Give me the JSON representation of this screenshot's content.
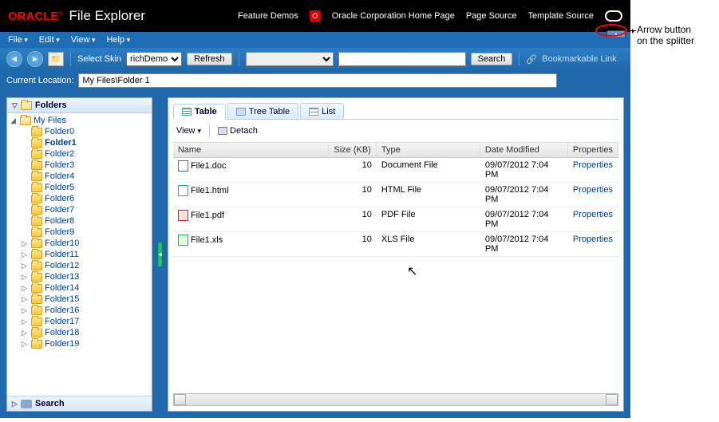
{
  "header": {
    "logo_brand": "ORACLE",
    "app_title": "File Explorer",
    "links": {
      "feature_demos": "Feature Demos",
      "home": "Oracle Corporation Home Page",
      "page_source": "Page Source",
      "template_source": "Template Source"
    }
  },
  "menubar": {
    "file": "File",
    "edit": "Edit",
    "view": "View",
    "help": "Help"
  },
  "toolbar": {
    "select_skin_label": "Select Skin",
    "skin_value": "richDemo",
    "refresh": "Refresh",
    "search": "Search",
    "bookmarkable": "Bookmarkable Link"
  },
  "location": {
    "label": "Current Location:",
    "value": "My Files\\Folder 1"
  },
  "sidebar": {
    "folders_title": "Folders",
    "search_title": "Search",
    "root": "My Files",
    "items": [
      {
        "label": "Folder0",
        "exp": false
      },
      {
        "label": "Folder1",
        "exp": false,
        "selected": true
      },
      {
        "label": "Folder2",
        "exp": false
      },
      {
        "label": "Folder3",
        "exp": false
      },
      {
        "label": "Folder4",
        "exp": false
      },
      {
        "label": "Folder5",
        "exp": false
      },
      {
        "label": "Folder6",
        "exp": false
      },
      {
        "label": "Folder7",
        "exp": false
      },
      {
        "label": "Folder8",
        "exp": false
      },
      {
        "label": "Folder9",
        "exp": false
      },
      {
        "label": "Folder10",
        "exp": true
      },
      {
        "label": "Folder11",
        "exp": true
      },
      {
        "label": "Folder12",
        "exp": true
      },
      {
        "label": "Folder13",
        "exp": true
      },
      {
        "label": "Folder14",
        "exp": true
      },
      {
        "label": "Folder15",
        "exp": true
      },
      {
        "label": "Folder16",
        "exp": true
      },
      {
        "label": "Folder17",
        "exp": true
      },
      {
        "label": "Folder18",
        "exp": true
      },
      {
        "label": "Folder19",
        "exp": true
      }
    ]
  },
  "tabs": {
    "table": "Table",
    "tree_table": "Tree Table",
    "list": "List"
  },
  "subtoolbar": {
    "view": "View",
    "detach": "Detach"
  },
  "grid": {
    "columns": {
      "name": "Name",
      "size": "Size (KB)",
      "type": "Type",
      "date": "Date Modified",
      "props": "Properties"
    },
    "rows": [
      {
        "name": "File1.doc",
        "icon": "doc",
        "size": "10",
        "type": "Document File",
        "date": "09/07/2012 7:04 PM",
        "props": "Properties"
      },
      {
        "name": "File1.html",
        "icon": "html",
        "size": "10",
        "type": "HTML File",
        "date": "09/07/2012 7:04 PM",
        "props": "Properties"
      },
      {
        "name": "File1.pdf",
        "icon": "pdf",
        "size": "10",
        "type": "PDF File",
        "date": "09/07/2012 7:04 PM",
        "props": "Properties"
      },
      {
        "name": "File1.xls",
        "icon": "xls",
        "size": "10",
        "type": "XLS File",
        "date": "09/07/2012 7:04 PM",
        "props": "Properties"
      }
    ]
  },
  "annotation": "Arrow button\non the splitter"
}
